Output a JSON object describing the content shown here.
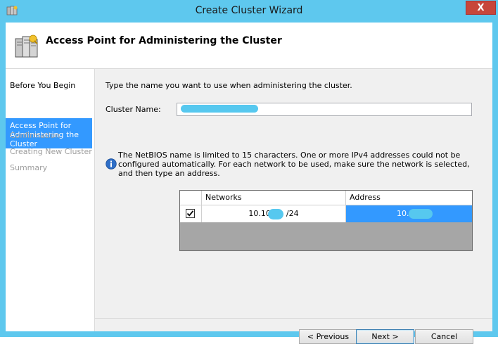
{
  "window": {
    "title": "Create Cluster Wizard",
    "close_label": "X"
  },
  "header": {
    "title": "Access Point for Administering the Cluster"
  },
  "steps": [
    {
      "label": "Before You Begin",
      "state": "done"
    },
    {
      "label": "Access Point for Administering the Cluster",
      "state": "current"
    },
    {
      "label": "Confirmation",
      "state": "pending"
    },
    {
      "label": "Creating New Cluster",
      "state": "pending"
    },
    {
      "label": "Summary",
      "state": "pending"
    }
  ],
  "content": {
    "instruction": "Type the name you want to use when administering the cluster.",
    "cluster_name_label": "Cluster Name:",
    "cluster_name_value": "",
    "info_text": "The NetBIOS name is limited to 15 characters.  One or more IPv4 addresses could not be configured automatically.  For each network to be used, make sure the network is selected, and then type an address.",
    "grid": {
      "columns": [
        "",
        "Networks",
        "Address"
      ],
      "rows": [
        {
          "checked": true,
          "network_prefix": "10.10",
          "network_suffix": "/24",
          "address_prefix": "10.10."
        }
      ]
    }
  },
  "buttons": {
    "previous": "< Previous",
    "next": "Next >",
    "cancel": "Cancel"
  },
  "colors": {
    "title_bar": "#5ec8ee",
    "selected_step": "#3399ff",
    "close_button": "#c7463a",
    "redaction_marks": "#56c8ef"
  }
}
